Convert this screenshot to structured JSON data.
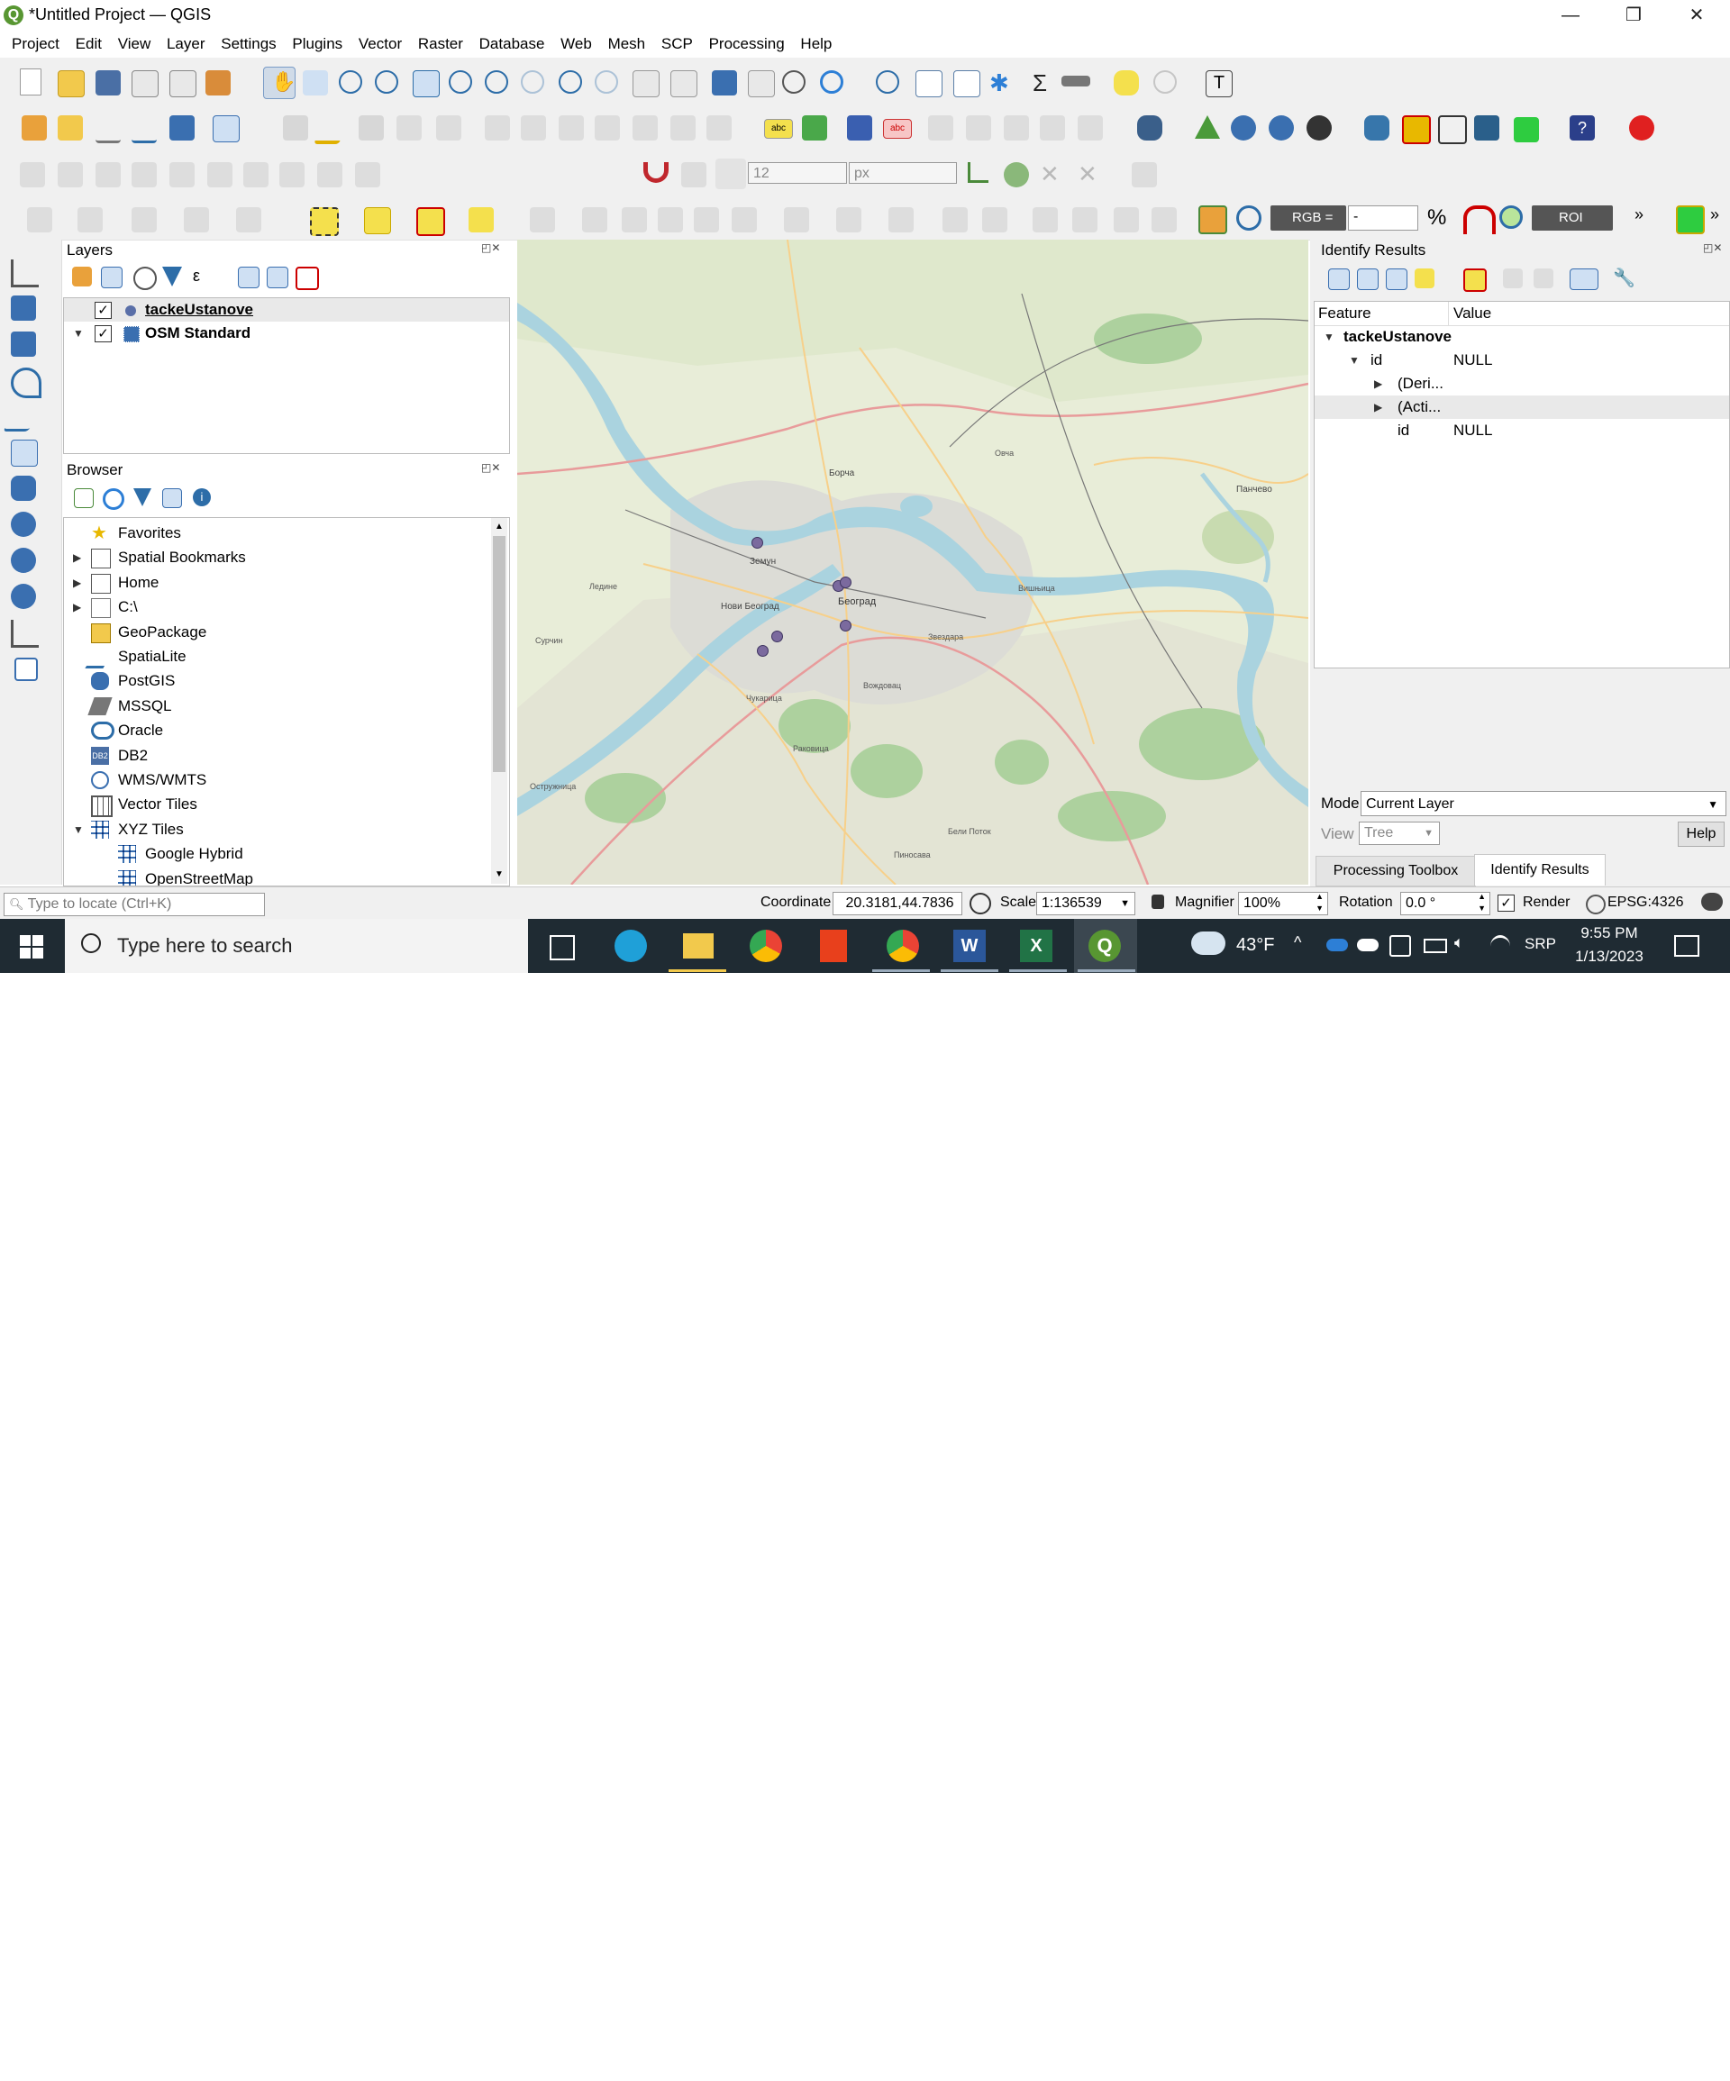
{
  "window": {
    "title": "*Untitled Project — QGIS",
    "logo_letter": "Q",
    "minimize_glyph": "—",
    "maximize_glyph": "❐",
    "close_glyph": "✕"
  },
  "menu": [
    "Project",
    "Edit",
    "View",
    "Layer",
    "Settings",
    "Plugins",
    "Vector",
    "Raster",
    "Database",
    "Web",
    "Mesh",
    "SCP",
    "Processing",
    "Help"
  ],
  "toolbar3": {
    "snap_tolerance": "12",
    "snap_units": "px"
  },
  "scp_toolbar": {
    "rgb_label": "RGB =",
    "rgb_value": "-",
    "roi_label": "ROI",
    "more": "»"
  },
  "layers_panel": {
    "title": "Layers",
    "items": [
      {
        "name": "tackeUstanove",
        "checked": true
      },
      {
        "name": "OSM Standard",
        "checked": true
      }
    ]
  },
  "browser_panel": {
    "title": "Browser",
    "items": [
      {
        "label": "Favorites",
        "icon": "star-icon",
        "expandable": false
      },
      {
        "label": "Spatial Bookmarks",
        "icon": "bookmark-icon",
        "expandable": true
      },
      {
        "label": "Home",
        "icon": "home-folder-icon",
        "expandable": true
      },
      {
        "label": "C:\\",
        "icon": "folder-icon",
        "expandable": true
      },
      {
        "label": "GeoPackage",
        "icon": "geopackage-icon",
        "expandable": false
      },
      {
        "label": "SpatiaLite",
        "icon": "spatialite-icon",
        "expandable": false
      },
      {
        "label": "PostGIS",
        "icon": "postgis-icon",
        "expandable": false
      },
      {
        "label": "MSSQL",
        "icon": "mssql-icon",
        "expandable": false
      },
      {
        "label": "Oracle",
        "icon": "oracle-icon",
        "expandable": false
      },
      {
        "label": "DB2",
        "icon": "db2-icon",
        "expandable": false
      },
      {
        "label": "WMS/WMTS",
        "icon": "wms-globe-icon",
        "expandable": false
      },
      {
        "label": "Vector Tiles",
        "icon": "vector-tiles-icon",
        "expandable": false
      },
      {
        "label": "XYZ Tiles",
        "icon": "xyz-tiles-icon",
        "expandable": true,
        "expanded": true
      },
      {
        "label": "Google Hybrid",
        "icon": "xyz-tiles-icon",
        "child": true
      },
      {
        "label": "OpenStreetMap",
        "icon": "xyz-tiles-icon",
        "child": true
      }
    ]
  },
  "map": {
    "labels": [
      "Београд",
      "Земун",
      "Борча",
      "Нови Београд",
      "Вишњица",
      "Звездара",
      "Вождовац",
      "Чукарица",
      "Раковица",
      "Бели Поток",
      "Пиносава",
      "Остружница",
      "Сурчин",
      "Ледине",
      "Овча",
      "Панчево"
    ],
    "point_color": "#7b6a9e"
  },
  "identify_panel": {
    "title": "Identify Results",
    "col_feature": "Feature",
    "col_value": "Value",
    "layer": "tackeUstanove",
    "rows": [
      {
        "feature": "id",
        "value": "NULL",
        "level": 1,
        "expander": "▼"
      },
      {
        "feature": "(Deri...",
        "value": "",
        "level": 2,
        "expander": "▶"
      },
      {
        "feature": "(Acti...",
        "value": "",
        "level": 2,
        "expander": "▶"
      },
      {
        "feature": "id",
        "value": "NULL",
        "level": 2,
        "expander": ""
      }
    ],
    "mode_label": "Mode",
    "mode_value": "Current Layer",
    "view_label": "View",
    "view_value": "Tree",
    "help_button": "Help",
    "tabs": [
      "Processing Toolbox",
      "Identify Results"
    ]
  },
  "statusbar": {
    "locate_placeholder": "Type to locate (Ctrl+K)",
    "coordinate_label": "Coordinate",
    "coordinate_value": "20.3181,44.7836",
    "scale_label": "Scale",
    "scale_value": "1:136539",
    "magnifier_label": "Magnifier",
    "magnifier_value": "100%",
    "rotation_label": "Rotation",
    "rotation_value": "0.0 °",
    "render_label": "Render",
    "crs": "EPSG:4326"
  },
  "taskbar": {
    "search_placeholder": "Type here to search",
    "temperature": "43°F",
    "language": "SRP",
    "time": "9:55 PM",
    "date": "1/13/2023",
    "caret": "^"
  },
  "colors": {
    "qgis_green": "#589632",
    "water": "#aad3df",
    "land": "#e8edd8",
    "forest": "#add19e",
    "taskbar": "#1f2b33"
  }
}
